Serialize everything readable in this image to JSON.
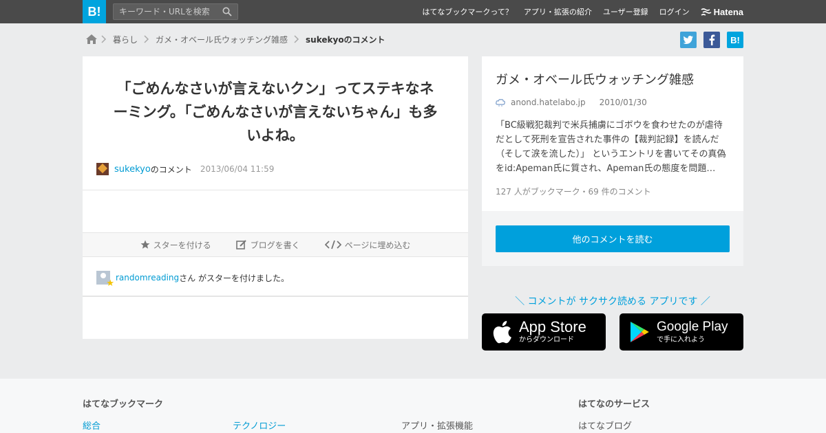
{
  "header": {
    "logo": "B!",
    "search_placeholder": "キーワード・URLを検索",
    "nav": [
      "はてなブックマークって？",
      "アプリ・拡張の紹介",
      "ユーザー登録",
      "ログイン"
    ],
    "brand": "Hatena"
  },
  "breadcrumb": {
    "items": [
      "暮らし",
      "ガメ・オベール氏ウォッチング雑感"
    ],
    "current": "sukekyoのコメント"
  },
  "share": {
    "twitter": "t",
    "facebook": "f",
    "hatena": "B!",
    "colors": {
      "twitter": "#3fa3d9",
      "facebook": "#3b5998",
      "hatena": "#00a4de"
    }
  },
  "comment": {
    "text": "「ごめんなさいが言えないクン」ってステキなネーミング。「ごめんなさいが言えないちゃん」も多いよね。",
    "user": "sukekyo",
    "suffix": "のコメント",
    "timestamp": "2013/06/04 11:59"
  },
  "actions": {
    "star": "スターを付ける",
    "blog": "ブログを書く",
    "embed": "ページに埋め込む"
  },
  "stars": {
    "user": "randomreading",
    "text": "さん がスターを付けました。"
  },
  "entry": {
    "title": "ガメ・オベール氏ウォッチング雑感",
    "domain": "anond.hatelabo.jp",
    "date": "2010/01/30",
    "body": "「BC級戦犯裁判で米兵捕虜にゴボウを食わせたのが虐待だとして死刑を宣告された事件の【裁判記録】を読んだ（そして涙を流した）」 というエントリを書いてその真偽をid:Apeman氏に質され、Apeman氏の態度を問題…",
    "counts": "127 人がブックマーク・69 件のコメント",
    "read_button": "他のコメントを読む"
  },
  "promo": {
    "tagline": "＼ コメントが サクサク読める アプリです ／",
    "appstore_big": "App Store",
    "appstore_small": "からダウンロード",
    "googleplay_big": "Google Play",
    "googleplay_small": "で手に入れよう"
  },
  "footer": {
    "bookmark_heading": "はてなブックマーク",
    "services_heading": "はてなのサービス",
    "links": [
      "総合",
      "テクノロジー",
      "アプリ・拡張機能",
      "はてなブログ"
    ]
  }
}
